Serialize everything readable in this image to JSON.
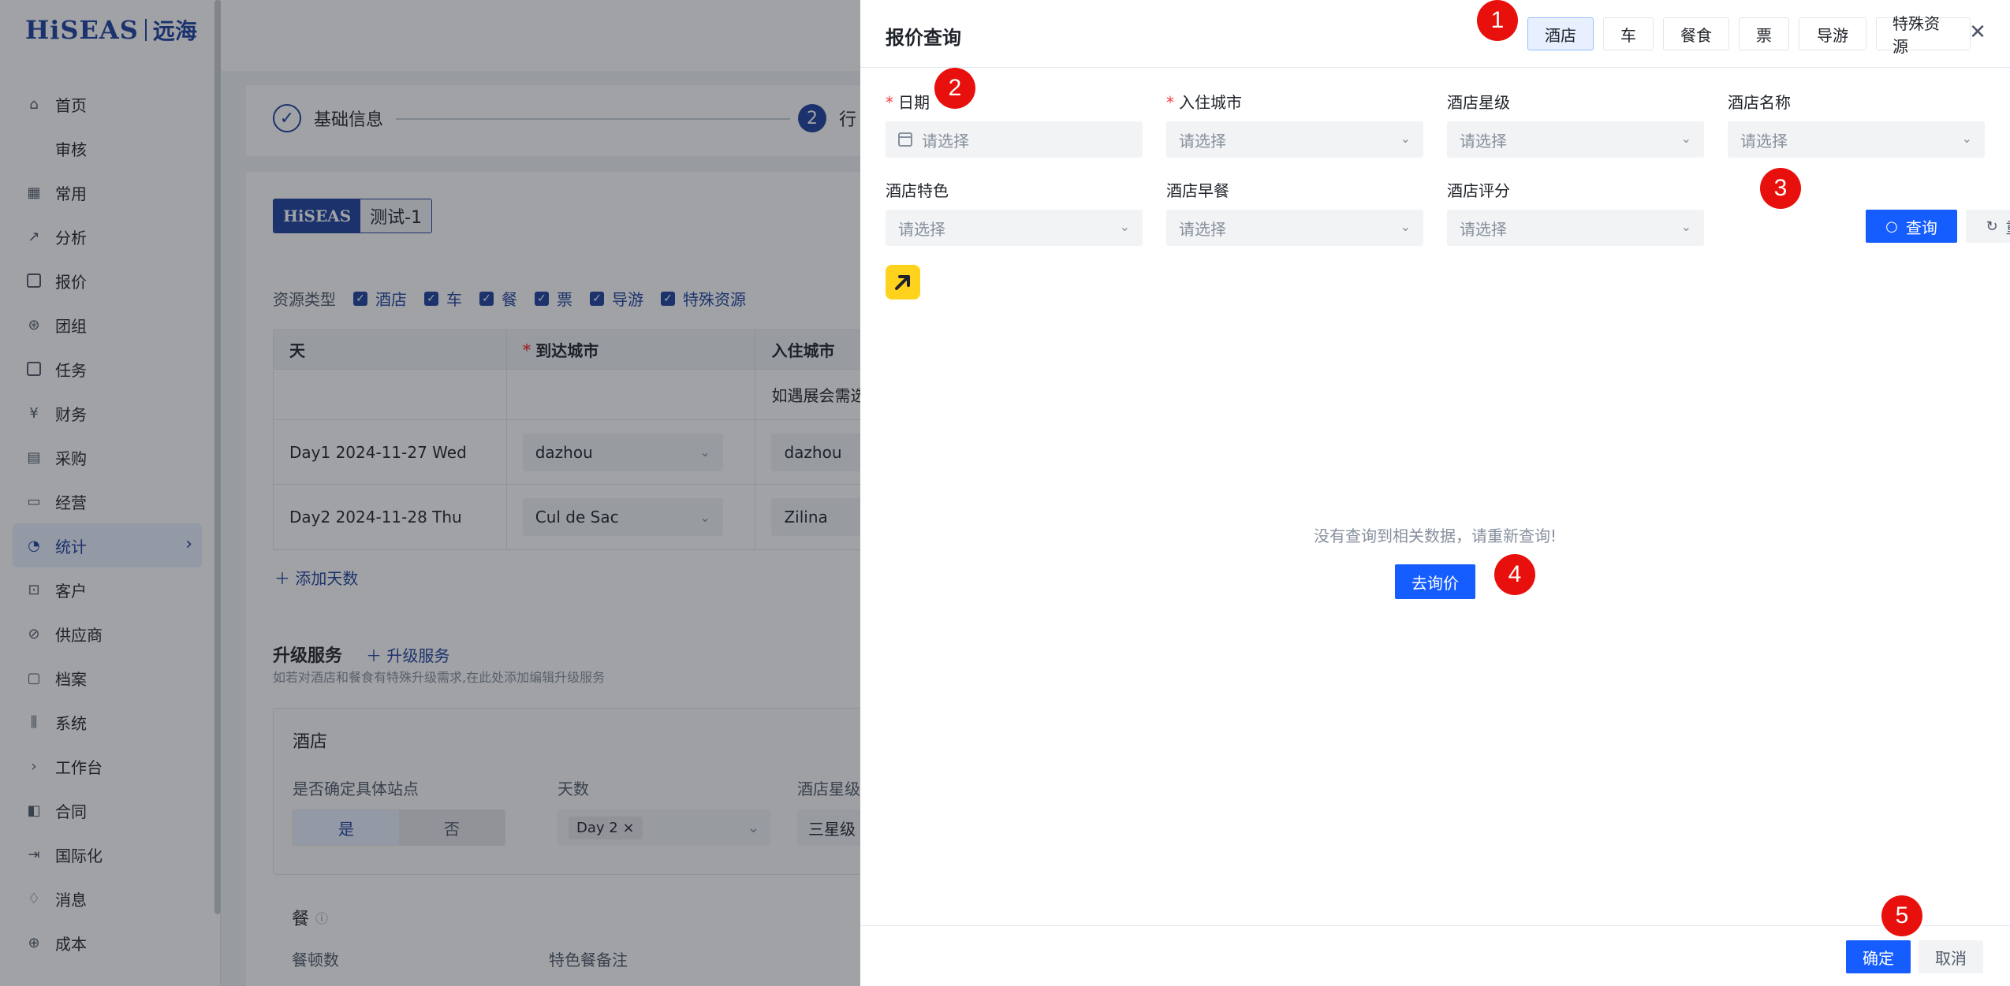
{
  "logo": {
    "brand": "HiSEAS",
    "brand_cn": "远海"
  },
  "sidebar": {
    "items": [
      {
        "label": "首页",
        "icon": "home-icon"
      },
      {
        "label": "审核",
        "icon": ""
      },
      {
        "label": "常用",
        "icon": "grid-icon"
      },
      {
        "label": "分析",
        "icon": "analysis-icon"
      },
      {
        "label": "报价",
        "icon": "quote-icon"
      },
      {
        "label": "团组",
        "icon": "group-icon"
      },
      {
        "label": "任务",
        "icon": "task-icon"
      },
      {
        "label": "财务",
        "icon": "finance-icon"
      },
      {
        "label": "采购",
        "icon": "purchase-icon"
      },
      {
        "label": "经营",
        "icon": "business-icon"
      },
      {
        "label": "统计",
        "icon": "statistics-icon",
        "active": true
      },
      {
        "label": "客户",
        "icon": "customer-icon"
      },
      {
        "label": "供应商",
        "icon": "supplier-icon"
      },
      {
        "label": "档案",
        "icon": "archive-icon"
      },
      {
        "label": "系统",
        "icon": "system-icon"
      },
      {
        "label": "工作台",
        "icon": "chevron-right-icon"
      },
      {
        "label": "合同",
        "icon": "contract-icon"
      },
      {
        "label": "国际化",
        "icon": "export-icon"
      },
      {
        "label": "消息",
        "icon": "bell-icon"
      },
      {
        "label": "成本",
        "icon": "cost-icon"
      }
    ]
  },
  "steps": {
    "s1_label": "基础信息",
    "s2_num": "2",
    "s2_label": "行"
  },
  "tag": {
    "brand": "HiSEAS",
    "name": "测试-1"
  },
  "resource": {
    "label": "资源类型",
    "types": [
      "酒店",
      "车",
      "餐",
      "票",
      "导游",
      "特殊资源"
    ]
  },
  "itinerary": {
    "headers": [
      "天",
      "到达城市",
      "入住城市"
    ],
    "hint": "如遇展会需选择",
    "rows": [
      {
        "day": "Day1 2024-11-27 Wed",
        "arrive": "dazhou",
        "stay": "dazhou"
      },
      {
        "day": "Day2 2024-11-28 Thu",
        "arrive": "Cul de Sac",
        "stay": "Zilina"
      }
    ],
    "add_days": "添加天数"
  },
  "upgrade": {
    "title": "升级服务",
    "link": "升级服务",
    "desc": "如若对酒店和餐食有特殊升级需求,在此处添加编辑升级服务"
  },
  "hotel_box": {
    "title": "酒店",
    "label_station": "是否确定具体站点",
    "label_days": "天数",
    "label_star": "酒店星级",
    "yes": "是",
    "no": "否",
    "days_chip": "Day 2",
    "star_value": "三星级"
  },
  "meal": {
    "title": "餐",
    "count_label": "餐顿数",
    "note_label": "特色餐备注"
  },
  "drawer": {
    "title": "报价查询",
    "tabs": [
      "酒店",
      "车",
      "餐食",
      "票",
      "导游",
      "特殊资源"
    ],
    "active_tab": 0,
    "fields": {
      "date_label": "日期",
      "city_label": "入住城市",
      "star_label": "酒店星级",
      "name_label": "酒店名称",
      "feature_label": "酒店特色",
      "breakfast_label": "酒店早餐",
      "rating_label": "酒店评分",
      "placeholder": "请选择"
    },
    "query_label": "查询",
    "reset_label": "重置",
    "empty_text": "没有查询到相关数据，请重新查询!",
    "inquiry_label": "去询价",
    "ok_label": "确定",
    "cancel_label": "取消"
  },
  "annotations": [
    "1",
    "2",
    "3",
    "4",
    "5"
  ],
  "colors": {
    "primary": "#165dff",
    "brand": "#1d3f9e",
    "badge": "#e8100c",
    "required": "#f53f3f"
  }
}
